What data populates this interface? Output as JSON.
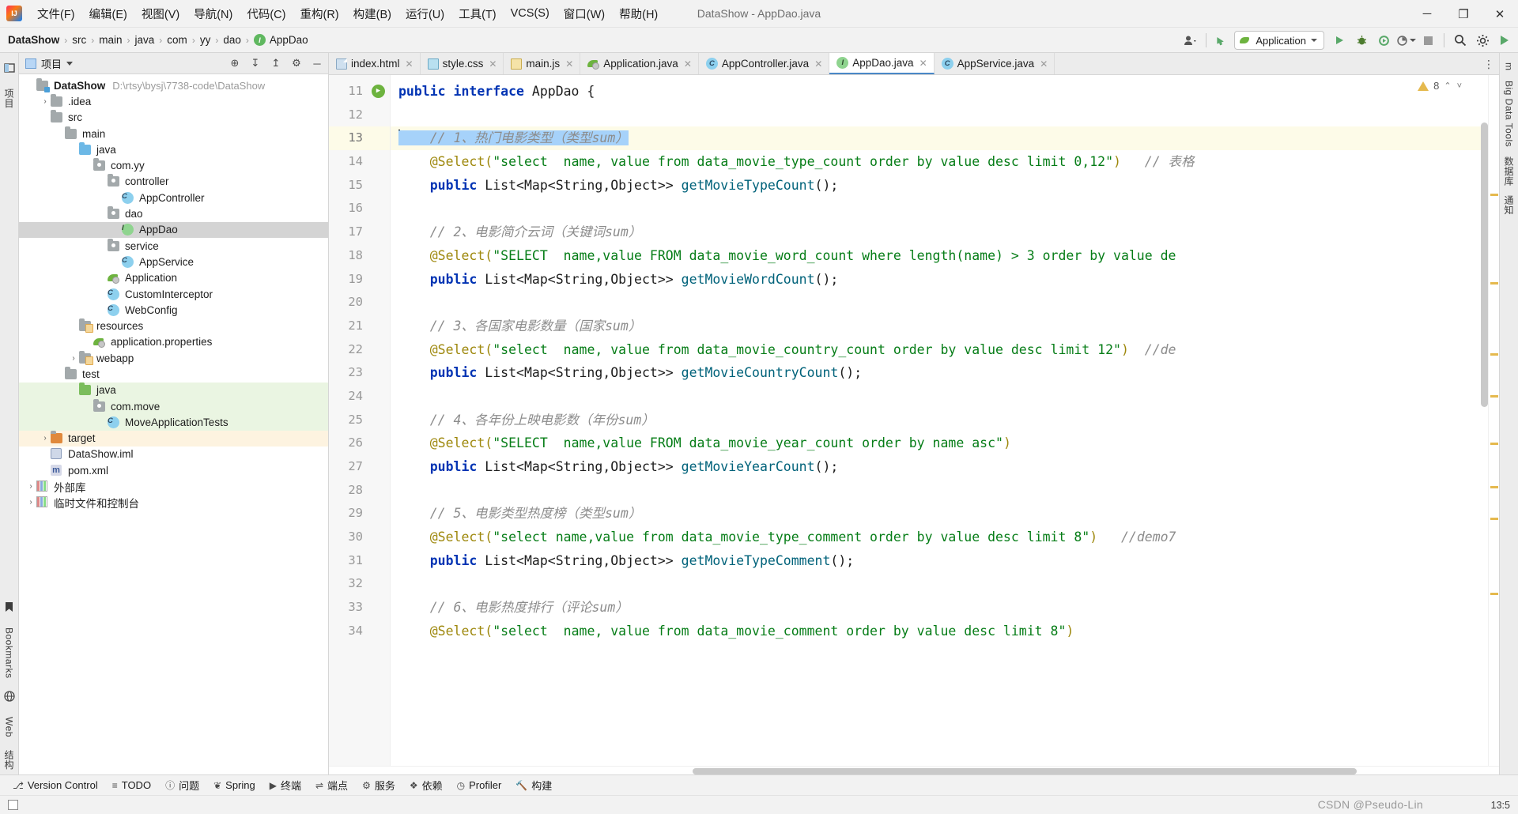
{
  "window": {
    "title": "DataShow - AppDao.java",
    "logo_icon": "intellij-idea-logo",
    "minimize": "─",
    "maximize": "❐",
    "close": "✕"
  },
  "menu": {
    "items": [
      {
        "label": "文件(F)"
      },
      {
        "label": "编辑(E)"
      },
      {
        "label": "视图(V)"
      },
      {
        "label": "导航(N)"
      },
      {
        "label": "代码(C)"
      },
      {
        "label": "重构(R)"
      },
      {
        "label": "构建(B)"
      },
      {
        "label": "运行(U)"
      },
      {
        "label": "工具(T)"
      },
      {
        "label": "VCS(S)"
      },
      {
        "label": "窗口(W)"
      },
      {
        "label": "帮助(H)"
      }
    ]
  },
  "breadcrumb": {
    "items": [
      "DataShow",
      "src",
      "main",
      "java",
      "com",
      "yy",
      "dao",
      "AppDao"
    ],
    "separator": "›",
    "leaf_icon": "interface-icon",
    "leaf_icon_letter": "I"
  },
  "toolbar": {
    "user_icon": "user-avatar-icon",
    "updates_icon": "green-arrow-update-icon",
    "run_config_name": "Application",
    "run_config_icon": "spring-boot-icon",
    "dropdown_caret": "▾",
    "run_icon": "▶",
    "debug_icon": "debug-bug-icon",
    "coverage_icon": "run-coverage-icon",
    "profile_icon": "profiler-icon",
    "stop_icon": "■",
    "search_icon": "🔍",
    "settings_icon": "⚙",
    "extra_icon": "search-everywhere-icon"
  },
  "project_panel": {
    "title": "项目",
    "title_icon": "project-view-icon",
    "dropdown_caret": "▾",
    "actions": [
      {
        "name": "locate-icon",
        "glyph": "⊕"
      },
      {
        "name": "expand-all-icon",
        "glyph": "↧"
      },
      {
        "name": "collapse-all-icon",
        "glyph": "↥"
      },
      {
        "name": "settings-gear-icon",
        "glyph": "⚙"
      },
      {
        "name": "hide-panel-icon",
        "glyph": "─"
      }
    ],
    "tree": [
      {
        "label": "DataShow",
        "path": "D:\\rtsy\\bysj\\7738-code\\DataShow",
        "indent": 0,
        "arrow": "ⱟ",
        "icon": "project-folder-icon",
        "bold": true,
        "scope": "none"
      },
      {
        "label": ".idea",
        "indent": 1,
        "arrow": "›",
        "icon": "folder-icon",
        "scope": "none"
      },
      {
        "label": "src",
        "indent": 1,
        "arrow": "ⱟ",
        "icon": "folder-icon",
        "scope": "none"
      },
      {
        "label": "main",
        "indent": 2,
        "arrow": "ⱟ",
        "icon": "folder-icon",
        "scope": "none"
      },
      {
        "label": "java",
        "indent": 3,
        "arrow": "ⱟ",
        "icon": "source-folder-icon",
        "scope": "none"
      },
      {
        "label": "com.yy",
        "indent": 4,
        "arrow": "ⱟ",
        "icon": "package-icon",
        "scope": "none"
      },
      {
        "label": "controller",
        "indent": 5,
        "arrow": "ⱟ",
        "icon": "package-icon",
        "scope": "none"
      },
      {
        "label": "AppController",
        "indent": 6,
        "arrow": "",
        "icon": "java-class-icon",
        "scope": "none"
      },
      {
        "label": "dao",
        "indent": 5,
        "arrow": "ⱟ",
        "icon": "package-icon",
        "scope": "none"
      },
      {
        "label": "AppDao",
        "indent": 6,
        "arrow": "",
        "icon": "java-interface-icon",
        "selected": true,
        "scope": "none"
      },
      {
        "label": "service",
        "indent": 5,
        "arrow": "ⱟ",
        "icon": "package-icon",
        "scope": "none"
      },
      {
        "label": "AppService",
        "indent": 6,
        "arrow": "",
        "icon": "java-class-icon",
        "scope": "none"
      },
      {
        "label": "Application",
        "indent": 5,
        "arrow": "",
        "icon": "spring-boot-class-icon",
        "scope": "none"
      },
      {
        "label": "CustomInterceptor",
        "indent": 5,
        "arrow": "",
        "icon": "java-class-icon",
        "scope": "none"
      },
      {
        "label": "WebConfig",
        "indent": 5,
        "arrow": "",
        "icon": "java-class-icon",
        "scope": "none"
      },
      {
        "label": "resources",
        "indent": 3,
        "arrow": "ⱟ",
        "icon": "resources-folder-icon",
        "scope": "none"
      },
      {
        "label": "application.properties",
        "indent": 4,
        "arrow": "",
        "icon": "spring-properties-icon",
        "scope": "none"
      },
      {
        "label": "webapp",
        "indent": 3,
        "arrow": "›",
        "icon": "resources-folder-icon",
        "scope": "none"
      },
      {
        "label": "test",
        "indent": 2,
        "arrow": "ⱟ",
        "icon": "folder-icon",
        "scope": "none"
      },
      {
        "label": "java",
        "indent": 3,
        "arrow": "ⱟ",
        "icon": "test-source-folder-icon",
        "scope": "test"
      },
      {
        "label": "com.move",
        "indent": 4,
        "arrow": "ⱟ",
        "icon": "package-icon",
        "scope": "test"
      },
      {
        "label": "MoveApplicationTests",
        "indent": 5,
        "arrow": "",
        "icon": "java-class-icon",
        "scope": "test"
      },
      {
        "label": "target",
        "indent": 1,
        "arrow": "›",
        "icon": "excluded-folder-icon",
        "scope": "target"
      },
      {
        "label": "DataShow.iml",
        "indent": 1,
        "arrow": "",
        "icon": "iml-module-icon",
        "scope": "none"
      },
      {
        "label": "pom.xml",
        "indent": 1,
        "arrow": "",
        "icon": "maven-pom-icon",
        "scope": "none"
      },
      {
        "label": "外部库",
        "indent": 0,
        "arrow": "›",
        "icon": "external-libraries-icon",
        "scope": "none"
      },
      {
        "label": "临时文件和控制台",
        "indent": 0,
        "arrow": "›",
        "icon": "scratches-icon",
        "scope": "none"
      }
    ]
  },
  "left_strip": {
    "items": [
      {
        "label": "项目",
        "name": "tool-window-project"
      },
      {
        "label": "Bookmarks",
        "name": "tool-window-bookmarks"
      },
      {
        "label": "Web",
        "name": "tool-window-web"
      },
      {
        "label": "结构",
        "name": "tool-window-structure"
      }
    ]
  },
  "right_strip": {
    "items": [
      {
        "label": "m",
        "name": "tool-window-maven"
      },
      {
        "label": "Big Data Tools",
        "name": "tool-window-big-data-tools"
      },
      {
        "label": "数据库",
        "name": "tool-window-database"
      },
      {
        "label": "通知",
        "name": "tool-window-notifications"
      }
    ]
  },
  "tabs": [
    {
      "label": "index.html",
      "icon": "html-file-icon",
      "active": false,
      "close": "✕"
    },
    {
      "label": "style.css",
      "icon": "css-file-icon",
      "active": false,
      "close": "✕"
    },
    {
      "label": "main.js",
      "icon": "js-file-icon",
      "active": false,
      "close": "✕"
    },
    {
      "label": "Application.java",
      "icon": "spring-boot-class-icon",
      "active": false,
      "close": "✕"
    },
    {
      "label": "AppController.java",
      "icon": "java-class-icon",
      "active": false,
      "close": "✕"
    },
    {
      "label": "AppDao.java",
      "icon": "java-interface-icon",
      "active": true,
      "close": "✕"
    },
    {
      "label": "AppService.java",
      "icon": "java-class-icon",
      "active": false,
      "close": "✕"
    }
  ],
  "tabs_overflow_icon": "⋮",
  "editor": {
    "inspection": {
      "warning_count": "8",
      "warning_icon": "warning-triangle-icon",
      "up_arrow": "⌃",
      "down_arrow": "˅"
    },
    "first_line_number": 11,
    "lines": [
      {
        "n": 11,
        "runmark": true,
        "highlight": false,
        "segments": [
          {
            "t": "public",
            "c": "kw"
          },
          {
            "t": " ",
            "c": "pl"
          },
          {
            "t": "interface",
            "c": "kw"
          },
          {
            "t": " AppDao {",
            "c": "pl"
          }
        ]
      },
      {
        "n": 12,
        "highlight": false,
        "segments": []
      },
      {
        "n": 13,
        "highlight": true,
        "caret": true,
        "selection": true,
        "segments": [
          {
            "t": "    // 1、热门电影类型（类型sum）",
            "c": "cm"
          }
        ]
      },
      {
        "n": 14,
        "highlight": false,
        "segments": [
          {
            "t": "    ",
            "c": "pl"
          },
          {
            "t": "@Select(",
            "c": "ann"
          },
          {
            "t": "\"select  name, value from data_movie_type_count order by value desc limit 0,12\"",
            "c": "str"
          },
          {
            "t": ")",
            "c": "ann"
          },
          {
            "t": "   // 表格",
            "c": "cm"
          }
        ]
      },
      {
        "n": 15,
        "highlight": false,
        "segments": [
          {
            "t": "    ",
            "c": "pl"
          },
          {
            "t": "public",
            "c": "kw"
          },
          {
            "t": " List<Map<String,Object>> ",
            "c": "pl"
          },
          {
            "t": "getMovieTypeCount",
            "c": "mth"
          },
          {
            "t": "();",
            "c": "pl"
          }
        ]
      },
      {
        "n": 16,
        "highlight": false,
        "segments": []
      },
      {
        "n": 17,
        "highlight": false,
        "segments": [
          {
            "t": "    // 2、电影简介云词（关键词sum）",
            "c": "cm"
          }
        ]
      },
      {
        "n": 18,
        "highlight": false,
        "segments": [
          {
            "t": "    ",
            "c": "pl"
          },
          {
            "t": "@Select(",
            "c": "ann"
          },
          {
            "t": "\"SELECT  name,value FROM data_movie_word_count where length(name) > 3 order by value de",
            "c": "str"
          }
        ]
      },
      {
        "n": 19,
        "highlight": false,
        "segments": [
          {
            "t": "    ",
            "c": "pl"
          },
          {
            "t": "public",
            "c": "kw"
          },
          {
            "t": " List<Map<String,Object>> ",
            "c": "pl"
          },
          {
            "t": "getMovieWordCount",
            "c": "mth"
          },
          {
            "t": "();",
            "c": "pl"
          }
        ]
      },
      {
        "n": 20,
        "highlight": false,
        "segments": []
      },
      {
        "n": 21,
        "highlight": false,
        "segments": [
          {
            "t": "    // 3、各国家电影数量（国家sum）",
            "c": "cm"
          }
        ]
      },
      {
        "n": 22,
        "highlight": false,
        "segments": [
          {
            "t": "    ",
            "c": "pl"
          },
          {
            "t": "@Select(",
            "c": "ann"
          },
          {
            "t": "\"select  name, value from data_movie_country_count order by value desc limit 12\"",
            "c": "str"
          },
          {
            "t": ")",
            "c": "ann"
          },
          {
            "t": "  //de",
            "c": "cm"
          }
        ]
      },
      {
        "n": 23,
        "highlight": false,
        "segments": [
          {
            "t": "    ",
            "c": "pl"
          },
          {
            "t": "public",
            "c": "kw"
          },
          {
            "t": " List<Map<String,Object>> ",
            "c": "pl"
          },
          {
            "t": "getMovieCountryCount",
            "c": "mth"
          },
          {
            "t": "();",
            "c": "pl"
          }
        ]
      },
      {
        "n": 24,
        "highlight": false,
        "segments": []
      },
      {
        "n": 25,
        "highlight": false,
        "segments": [
          {
            "t": "    // 4、各年份上映电影数（年份sum）",
            "c": "cm"
          }
        ]
      },
      {
        "n": 26,
        "highlight": false,
        "segments": [
          {
            "t": "    ",
            "c": "pl"
          },
          {
            "t": "@Select(",
            "c": "ann"
          },
          {
            "t": "\"SELECT  name,value FROM data_movie_year_count order by name asc\"",
            "c": "str"
          },
          {
            "t": ")",
            "c": "ann"
          }
        ]
      },
      {
        "n": 27,
        "highlight": false,
        "segments": [
          {
            "t": "    ",
            "c": "pl"
          },
          {
            "t": "public",
            "c": "kw"
          },
          {
            "t": " List<Map<String,Object>> ",
            "c": "pl"
          },
          {
            "t": "getMovieYearCount",
            "c": "mth"
          },
          {
            "t": "();",
            "c": "pl"
          }
        ]
      },
      {
        "n": 28,
        "highlight": false,
        "segments": []
      },
      {
        "n": 29,
        "highlight": false,
        "segments": [
          {
            "t": "    // 5、电影类型热度榜（类型sum）",
            "c": "cm"
          }
        ]
      },
      {
        "n": 30,
        "highlight": false,
        "segments": [
          {
            "t": "    ",
            "c": "pl"
          },
          {
            "t": "@Select(",
            "c": "ann"
          },
          {
            "t": "\"select name,value from data_movie_type_comment order by value desc limit 8\"",
            "c": "str"
          },
          {
            "t": ")",
            "c": "ann"
          },
          {
            "t": "   //demo7",
            "c": "cm"
          }
        ]
      },
      {
        "n": 31,
        "highlight": false,
        "segments": [
          {
            "t": "    ",
            "c": "pl"
          },
          {
            "t": "public",
            "c": "kw"
          },
          {
            "t": " List<Map<String,Object>> ",
            "c": "pl"
          },
          {
            "t": "getMovieTypeComment",
            "c": "mth"
          },
          {
            "t": "();",
            "c": "pl"
          }
        ]
      },
      {
        "n": 32,
        "highlight": false,
        "segments": []
      },
      {
        "n": 33,
        "highlight": false,
        "segments": [
          {
            "t": "    // 6、电影热度排行（评论sum）",
            "c": "cm"
          }
        ]
      },
      {
        "n": 34,
        "highlight": false,
        "segments": [
          {
            "t": "    ",
            "c": "pl"
          },
          {
            "t": "@Select(",
            "c": "ann"
          },
          {
            "t": "\"select  name, value from data_movie_comment order by value desc limit 8\"",
            "c": "str"
          },
          {
            "t": ")",
            "c": "ann"
          }
        ]
      }
    ]
  },
  "bottom_bar": {
    "items": [
      {
        "label": "Version Control",
        "icon": "version-control-icon",
        "glyph": "⎇"
      },
      {
        "label": "TODO",
        "icon": "todo-icon",
        "glyph": "≡"
      },
      {
        "label": "问题",
        "icon": "problems-icon",
        "glyph": "ⓘ"
      },
      {
        "label": "Spring",
        "icon": "spring-icon",
        "glyph": "❦"
      },
      {
        "label": "终端",
        "icon": "terminal-icon",
        "glyph": "▶"
      },
      {
        "label": "端点",
        "icon": "endpoints-icon",
        "glyph": "⇌"
      },
      {
        "label": "服务",
        "icon": "services-icon",
        "glyph": "⚙"
      },
      {
        "label": "依赖",
        "icon": "dependencies-icon",
        "glyph": "❖"
      },
      {
        "label": "Profiler",
        "icon": "profiler-icon",
        "glyph": "◷"
      },
      {
        "label": "构建",
        "icon": "build-icon",
        "glyph": "🔨"
      }
    ]
  },
  "status_bar": {
    "watermark": "CSDN @Pseudo-Lin",
    "position": "13:5",
    "indicator_icon": "status-square-icon"
  }
}
